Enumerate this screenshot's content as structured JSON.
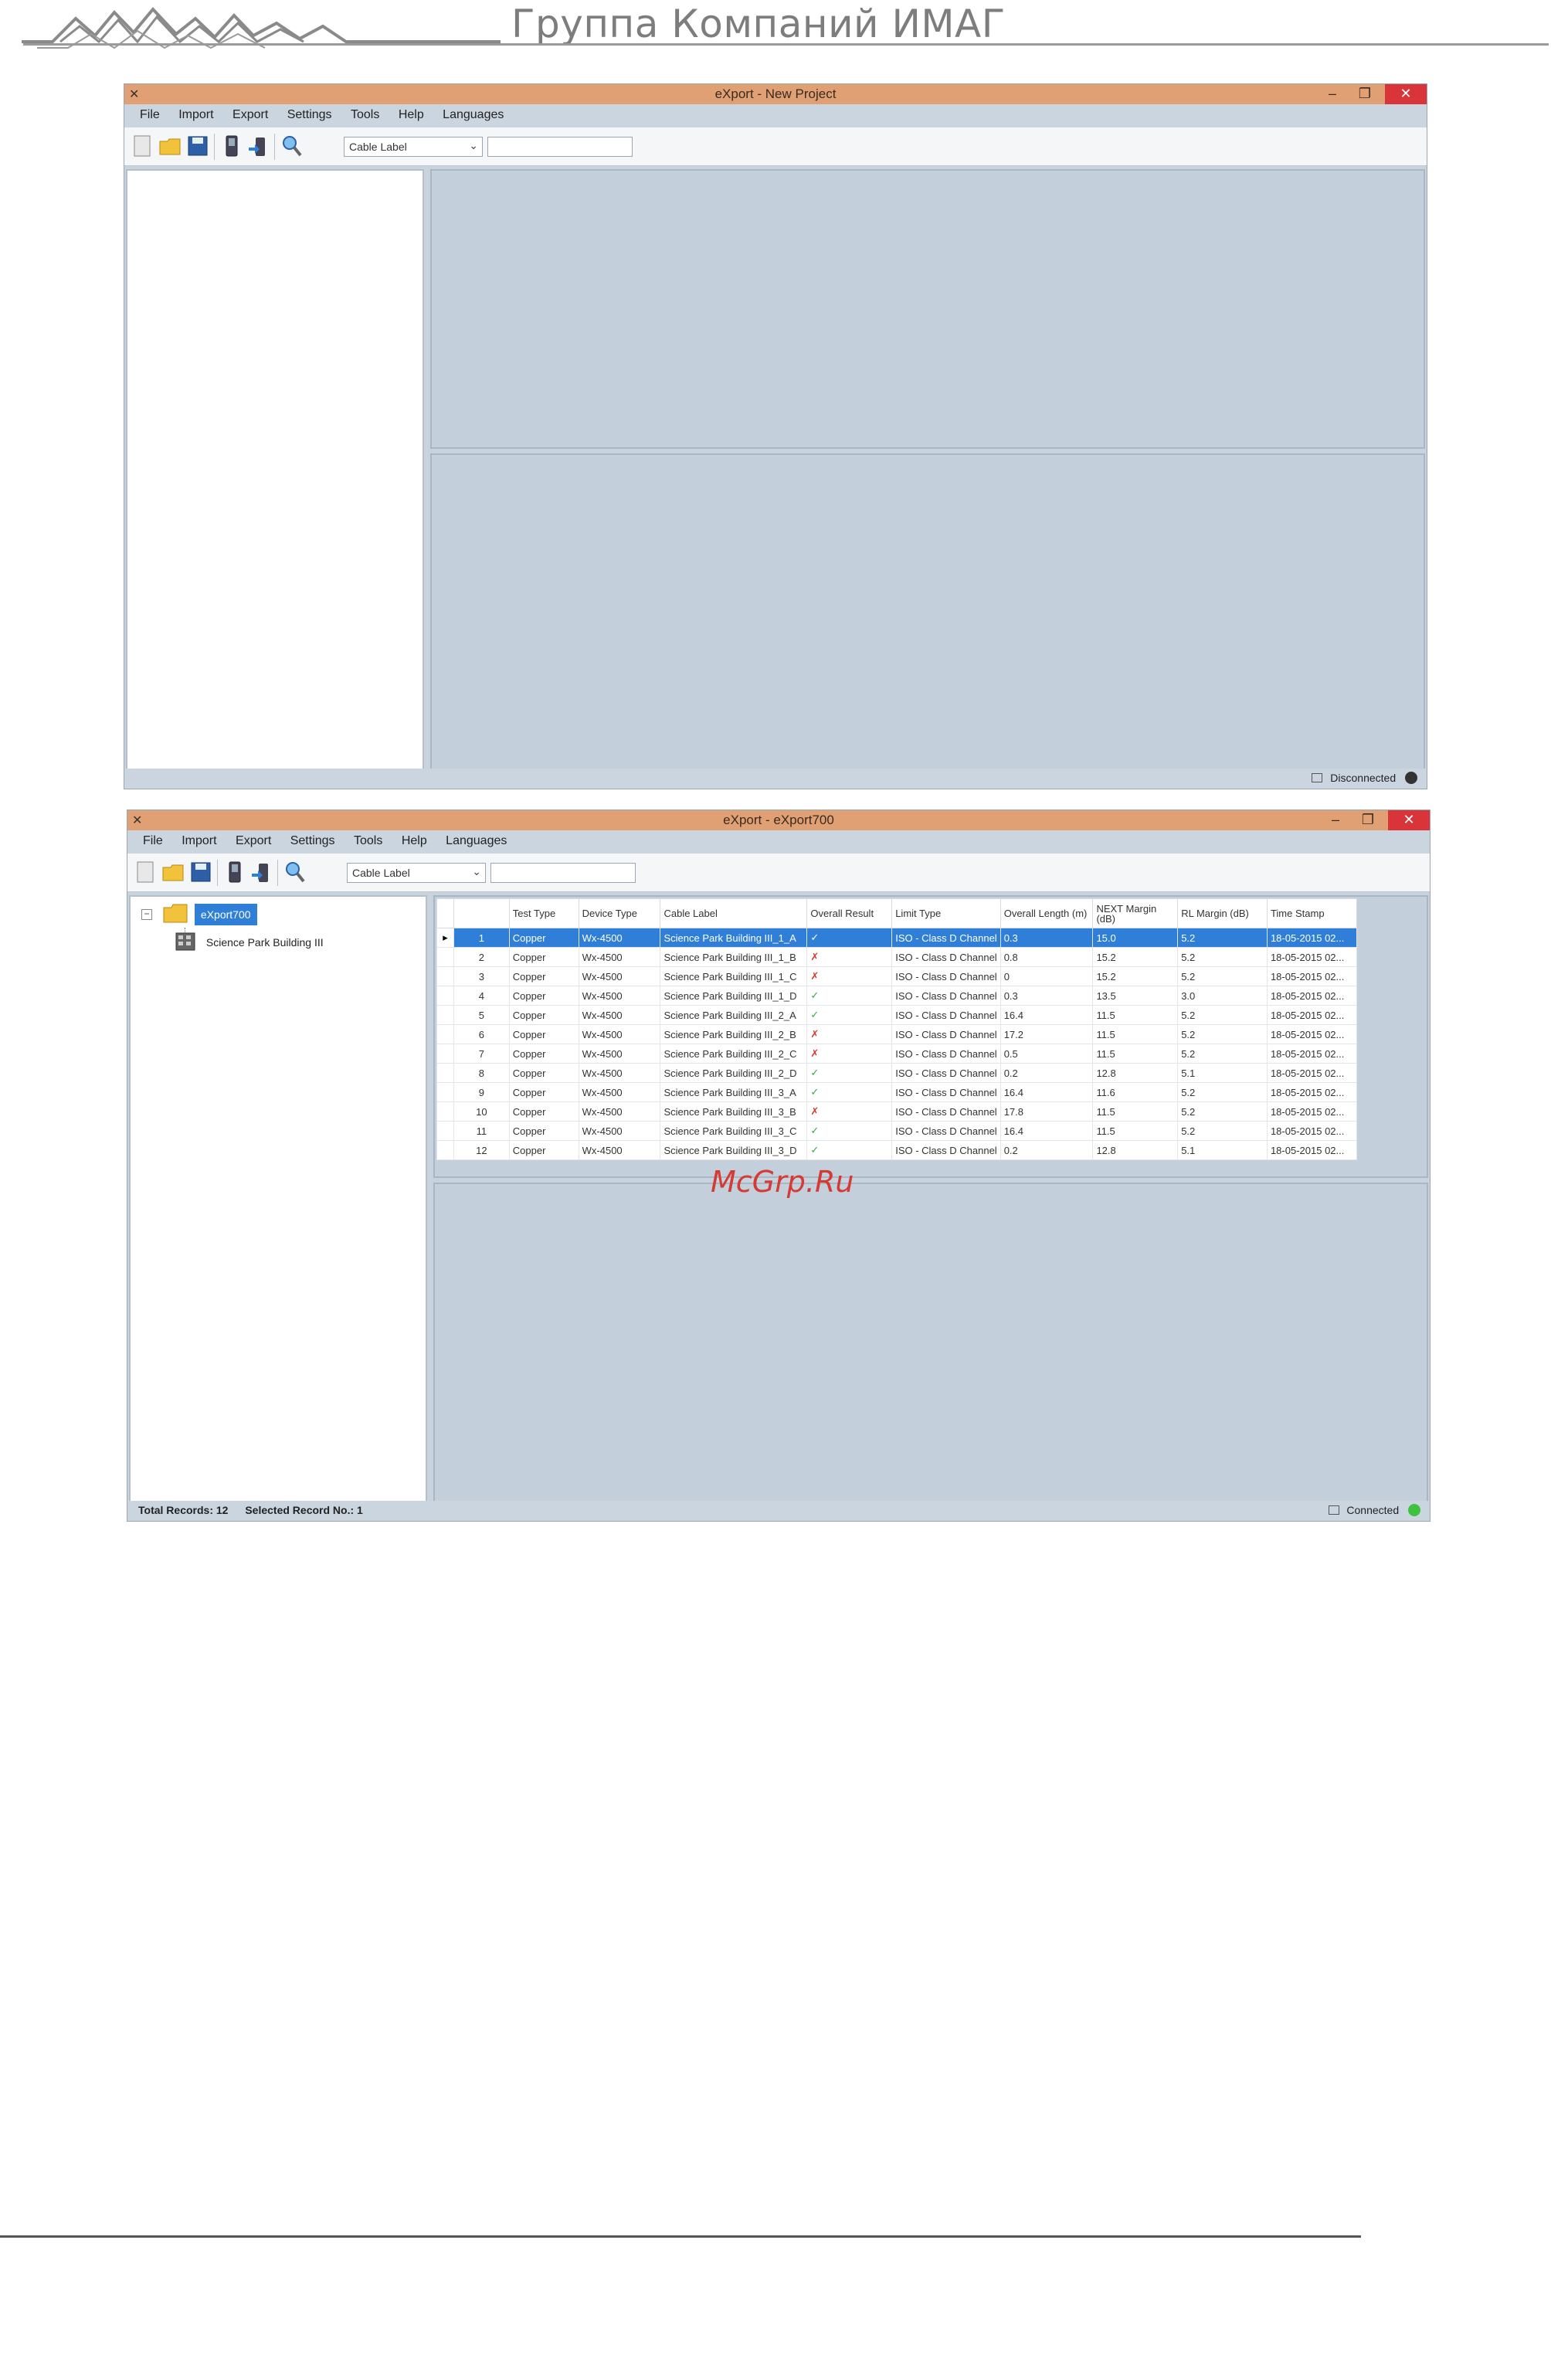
{
  "header": {
    "company_name": "Группа Компаний ИМАГ",
    "logo_icon": "mountains-logo-icon"
  },
  "window1": {
    "title": "eXport - New Project",
    "menu": [
      "File",
      "Import",
      "Export",
      "Settings",
      "Tools",
      "Help",
      "Languages"
    ],
    "search_by": "Cable Label",
    "search_value": "",
    "status": "Disconnected",
    "status_color": "#333333"
  },
  "window2": {
    "title": "eXport - eXport700",
    "menu": [
      "File",
      "Import",
      "Export",
      "Settings",
      "Tools",
      "Help",
      "Languages"
    ],
    "search_by": "Cable Label",
    "search_value": "",
    "tree": {
      "root": "eXport700",
      "child": "Science Park Building III"
    },
    "table": {
      "columns": [
        "",
        "",
        "Test Type",
        "Device Type",
        "Cable Label",
        "Overall Result",
        "Limit Type",
        "Overall Length (m)",
        "NEXT Margin (dB)",
        "RL Margin (dB)",
        "Time Stamp"
      ],
      "rows": [
        {
          "n": "1",
          "test": "Copper",
          "device": "Wx-4500",
          "label": "Science Park Building III_1_A",
          "result": "pass",
          "limit": "ISO - Class D Channel",
          "length": "0.3",
          "next": "15.0",
          "rl": "5.2",
          "time": "18-05-2015 02..."
        },
        {
          "n": "2",
          "test": "Copper",
          "device": "Wx-4500",
          "label": "Science Park Building III_1_B",
          "result": "fail",
          "limit": "ISO - Class D Channel",
          "length": "0.8",
          "next": "15.2",
          "rl": "5.2",
          "time": "18-05-2015 02..."
        },
        {
          "n": "3",
          "test": "Copper",
          "device": "Wx-4500",
          "label": "Science Park Building III_1_C",
          "result": "fail",
          "limit": "ISO - Class D Channel",
          "length": "0",
          "next": "15.2",
          "rl": "5.2",
          "time": "18-05-2015 02..."
        },
        {
          "n": "4",
          "test": "Copper",
          "device": "Wx-4500",
          "label": "Science Park Building III_1_D",
          "result": "pass",
          "limit": "ISO - Class D Channel",
          "length": "0.3",
          "next": "13.5",
          "rl": "3.0",
          "time": "18-05-2015 02..."
        },
        {
          "n": "5",
          "test": "Copper",
          "device": "Wx-4500",
          "label": "Science Park Building III_2_A",
          "result": "pass",
          "limit": "ISO - Class D Channel",
          "length": "16.4",
          "next": "11.5",
          "rl": "5.2",
          "time": "18-05-2015 02..."
        },
        {
          "n": "6",
          "test": "Copper",
          "device": "Wx-4500",
          "label": "Science Park Building III_2_B",
          "result": "fail",
          "limit": "ISO - Class D Channel",
          "length": "17.2",
          "next": "11.5",
          "rl": "5.2",
          "time": "18-05-2015 02..."
        },
        {
          "n": "7",
          "test": "Copper",
          "device": "Wx-4500",
          "label": "Science Park Building III_2_C",
          "result": "fail",
          "limit": "ISO - Class D Channel",
          "length": "0.5",
          "next": "11.5",
          "rl": "5.2",
          "time": "18-05-2015 02..."
        },
        {
          "n": "8",
          "test": "Copper",
          "device": "Wx-4500",
          "label": "Science Park Building III_2_D",
          "result": "pass",
          "limit": "ISO - Class D Channel",
          "length": "0.2",
          "next": "12.8",
          "rl": "5.1",
          "time": "18-05-2015 02..."
        },
        {
          "n": "9",
          "test": "Copper",
          "device": "Wx-4500",
          "label": "Science Park Building III_3_A",
          "result": "pass",
          "limit": "ISO - Class D Channel",
          "length": "16.4",
          "next": "11.6",
          "rl": "5.2",
          "time": "18-05-2015 02..."
        },
        {
          "n": "10",
          "test": "Copper",
          "device": "Wx-4500",
          "label": "Science Park Building III_3_B",
          "result": "fail",
          "limit": "ISO - Class D Channel",
          "length": "17.8",
          "next": "11.5",
          "rl": "5.2",
          "time": "18-05-2015 02..."
        },
        {
          "n": "11",
          "test": "Copper",
          "device": "Wx-4500",
          "label": "Science Park Building III_3_C",
          "result": "pass",
          "limit": "ISO - Class D Channel",
          "length": "16.4",
          "next": "11.5",
          "rl": "5.2",
          "time": "18-05-2015 02..."
        },
        {
          "n": "12",
          "test": "Copper",
          "device": "Wx-4500",
          "label": "Science Park Building III_3_D",
          "result": "pass",
          "limit": "ISO - Class D Channel",
          "length": "0.2",
          "next": "12.8",
          "rl": "5.1",
          "time": "18-05-2015 02..."
        }
      ],
      "selected_index": 0
    },
    "status_total": "Total Records: 12",
    "status_selected": "Selected Record No.: 1",
    "status": "Connected",
    "status_color": "#3fc23f"
  },
  "watermark": "McGrp.Ru",
  "colors": {
    "titlebar": "#e0a074",
    "selection": "#2f7fd8",
    "pass": "#3aa843",
    "fail": "#d63a2a",
    "close_button": "#d8343a"
  }
}
